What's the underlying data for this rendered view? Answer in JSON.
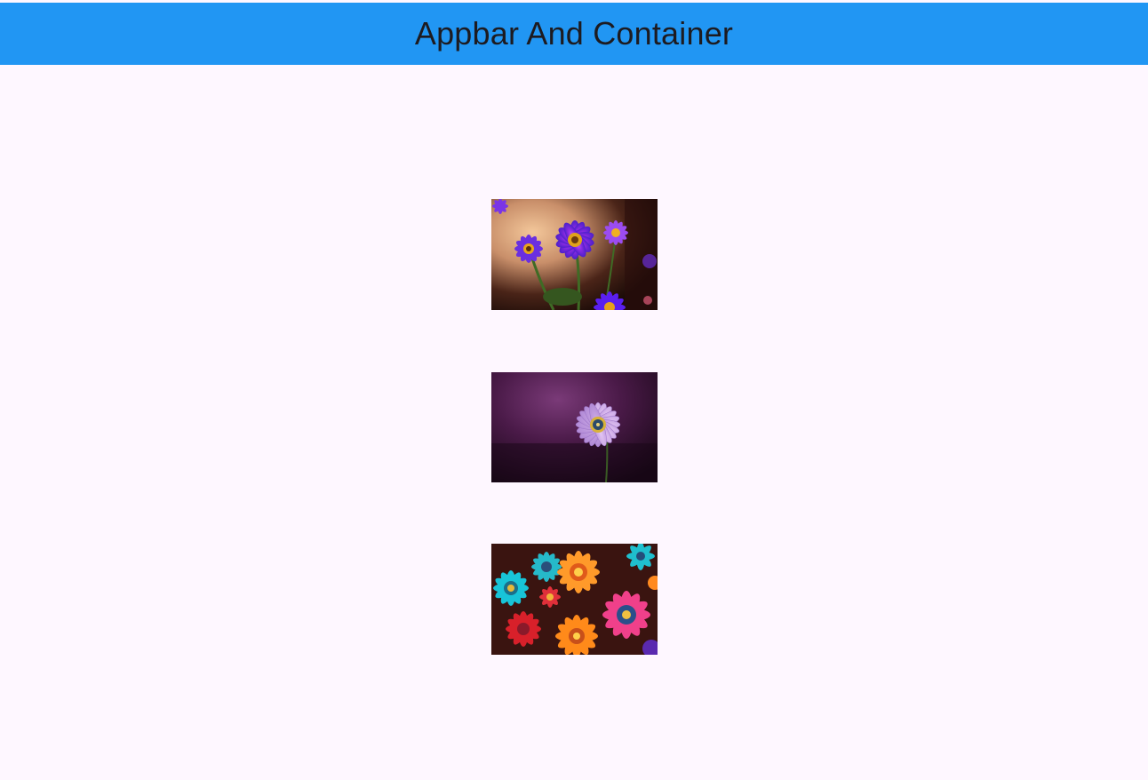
{
  "app_bar": {
    "title": "Appbar And Container",
    "background": "#2196f3",
    "title_color": "#1d1b20"
  },
  "page": {
    "background": "#fef7ff"
  },
  "images": [
    {
      "name": "flower-image-purple-daisies"
    },
    {
      "name": "flower-image-lilac-dewdrop-daisy"
    },
    {
      "name": "flower-image-colorful-gerberas"
    }
  ]
}
